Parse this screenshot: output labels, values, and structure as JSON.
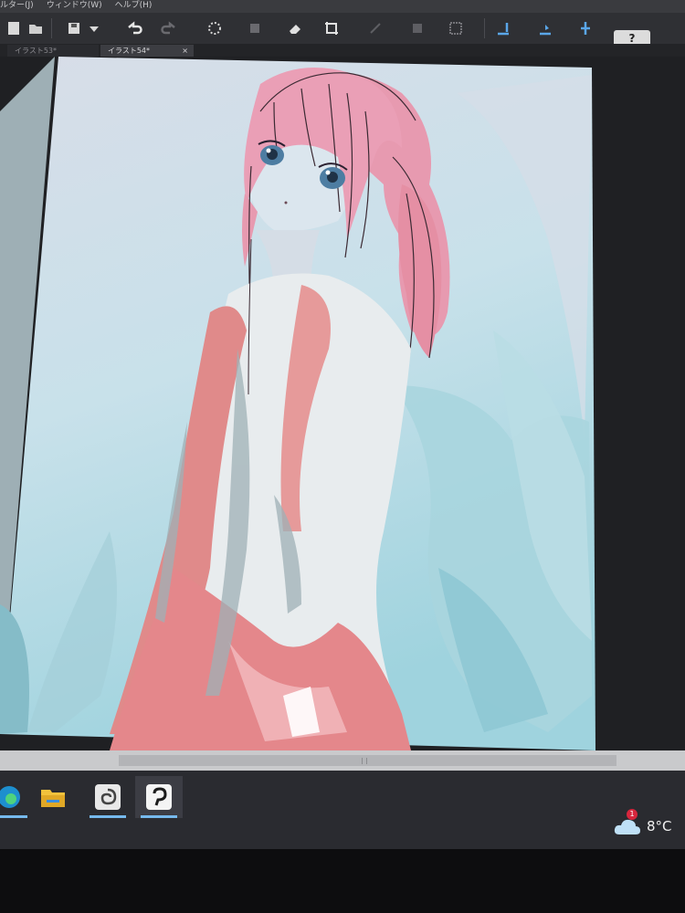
{
  "menubar": {
    "items": [
      "ルター(J)",
      "ウィンドウ(W)",
      "ヘルプ(H)"
    ]
  },
  "toolbar": {
    "help_label": "?"
  },
  "tabs": [
    {
      "label": "イラスト53*",
      "active": false
    },
    {
      "label": "イラスト54*",
      "active": true
    }
  ],
  "tab_close": "×",
  "taskbar": {
    "apps": [
      {
        "icon": "edge-icon"
      },
      {
        "icon": "file-explorer-icon"
      },
      {
        "icon": "clip-studio-icon"
      },
      {
        "icon": "clip-studio-paint-icon"
      }
    ],
    "weather": {
      "temperature": "8°C",
      "badge": "1",
      "icon": "cloud-icon"
    }
  },
  "colors": {
    "accent": "#76b9ed",
    "taskbar": "#2a2b30",
    "toolbar": "#2f3034",
    "skirt": "#e08a8a",
    "hair": "#e79ab0",
    "background_light": "#c7e2ea",
    "background_teal": "#8cc9d6"
  }
}
